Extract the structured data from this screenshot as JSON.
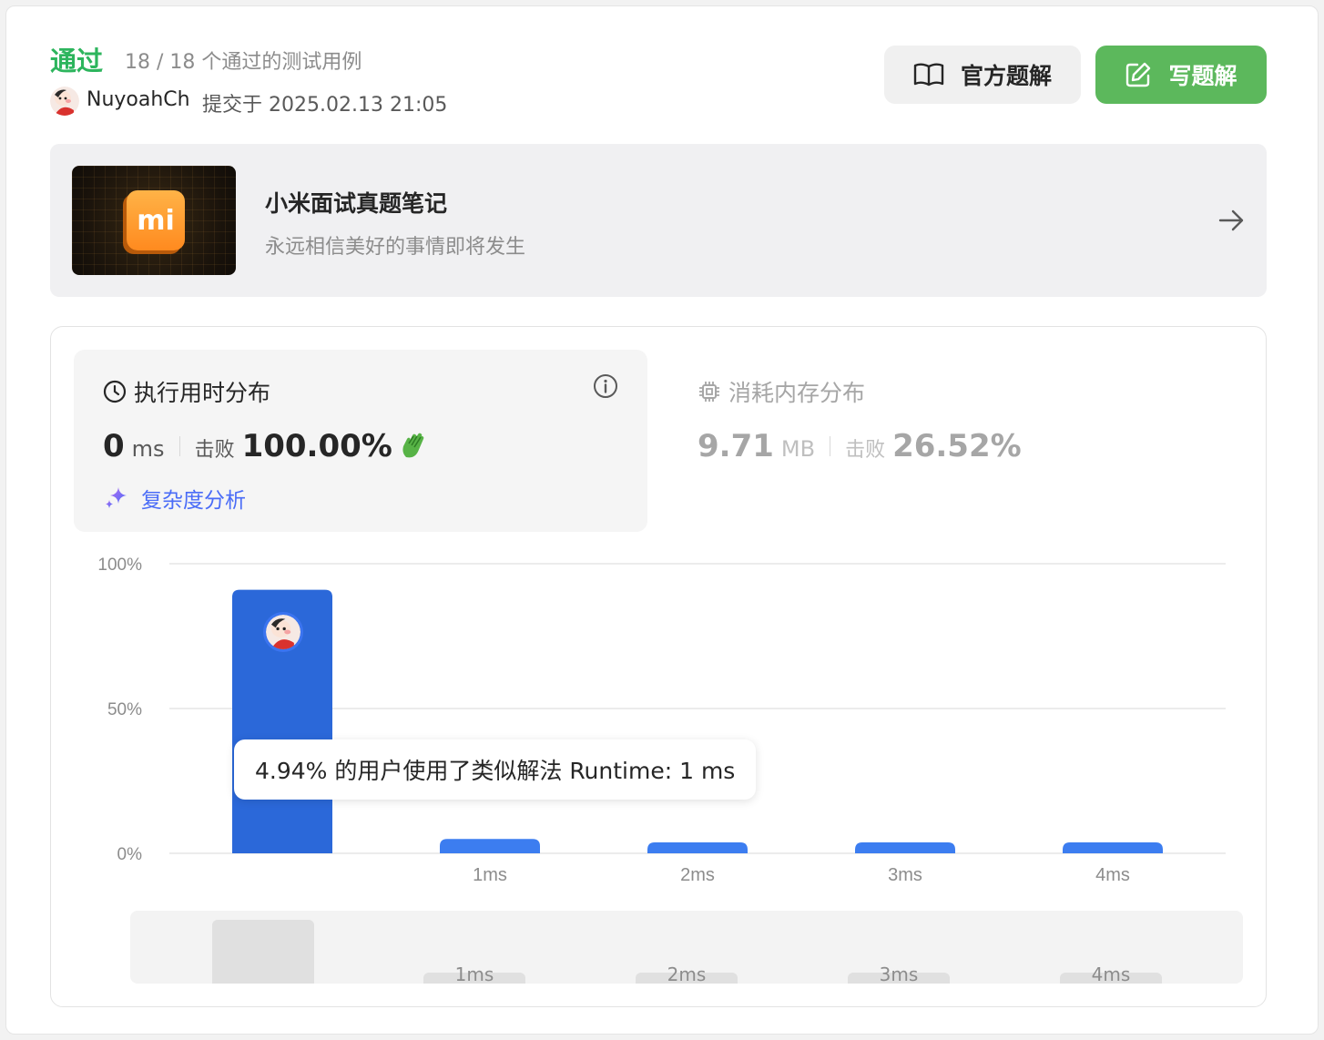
{
  "header": {
    "status": "通过",
    "cases": "18 / 18 个通过的测试用例",
    "username": "NuyoahCh",
    "submitted": "提交于 2025.02.13 21:05",
    "official_solution_label": "官方题解",
    "write_solution_label": "写题解"
  },
  "banner": {
    "logo_text": "mi",
    "title": "小米面试真题笔记",
    "subtitle": "永远相信美好的事情即将发生"
  },
  "runtime": {
    "title": "执行用时分布",
    "value": "0",
    "unit": "ms",
    "beat_label": "击败",
    "beat_value": "100.00%",
    "complexity_label": "复杂度分析"
  },
  "memory": {
    "title": "消耗内存分布",
    "value": "9.71",
    "unit": "MB",
    "beat_label": "击败",
    "beat_value": "26.52%"
  },
  "tooltip": "4.94% 的用户使用了类似解法 Runtime: 1 ms",
  "colors": {
    "accent_green": "#2db55d",
    "button_green": "#5cb85c",
    "bar_blue": "#2f6ee0",
    "link_blue": "#4a6cf7"
  },
  "chart_data": {
    "type": "bar",
    "categories": [
      "",
      "1ms",
      "2ms",
      "3ms",
      "4ms"
    ],
    "values": [
      91,
      4.94,
      2,
      2,
      2
    ],
    "y_tick_labels": [
      "100%",
      "50%",
      "0%"
    ],
    "ylim": [
      0,
      100
    ],
    "grid": true,
    "title": "",
    "xlabel": "",
    "ylabel": ""
  },
  "minimap": {
    "labels": [
      "1ms",
      "2ms",
      "3ms",
      "4ms"
    ]
  }
}
